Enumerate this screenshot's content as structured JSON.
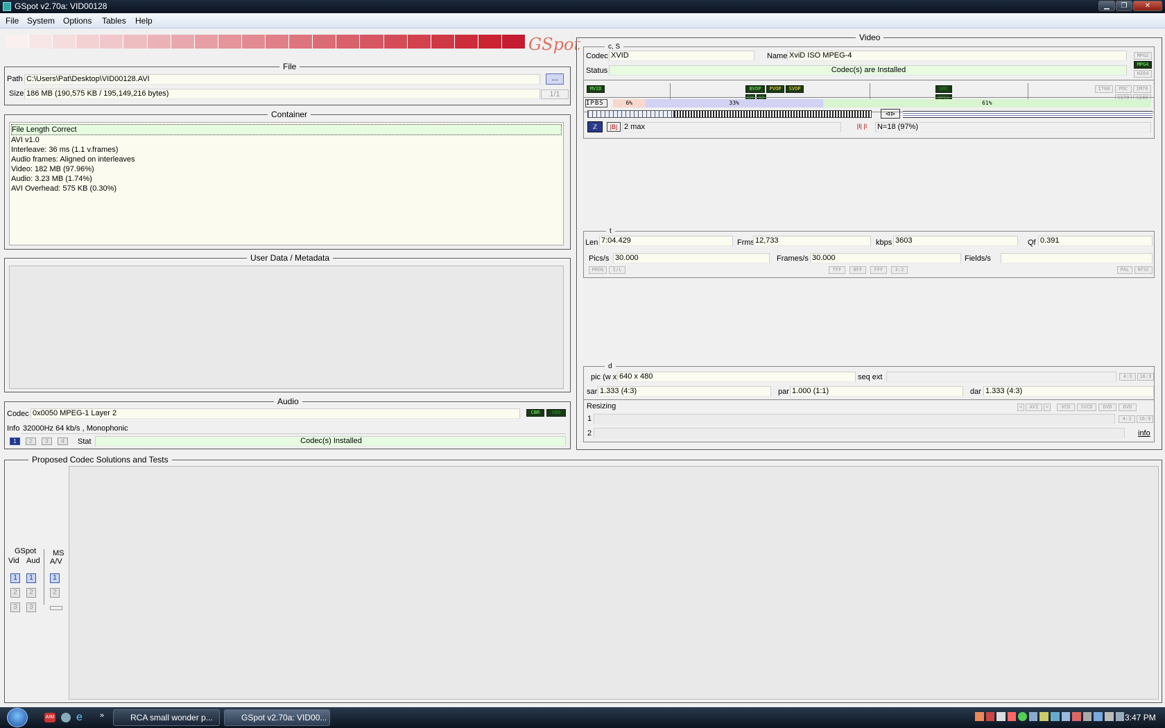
{
  "window": {
    "title": "GSpot v2.70a: VID00128"
  },
  "menu": [
    "File",
    "System",
    "Options",
    "Tables",
    "Help"
  ],
  "logo": "GSpot",
  "colors": {
    "accent_red": "#c41c30",
    "status_green": "#e6fbe0",
    "field_bg": "#fbfbf0"
  },
  "file": {
    "title": "File",
    "path_label": "Path",
    "path": "C:\\Users\\Pat\\Desktop\\VID00128.AVI",
    "browse": "...",
    "size_label": "Size",
    "size": "186 MB (190,575 KB / 195,149,216 bytes)",
    "counter": "1/1"
  },
  "container": {
    "title": "Container",
    "lines": [
      "File Length Correct",
      "AVI v1.0",
      "Interleave: 36 ms (1.1 v.frames)",
      "Audio frames: Aligned on interleaves",
      "Video: 182 MB (97.96%)",
      "Audio: 3.23 MB (1.74%)",
      "AVI Overhead: 575 KB (0.30%)"
    ]
  },
  "userdata": {
    "title": "User Data / Metadata"
  },
  "audio": {
    "title": "Audio",
    "codec_label": "Codec",
    "codec": "0x0050 MPEG-1 Layer 2",
    "cbr": "CBR",
    "vbr": "VBR",
    "info_label": "Info",
    "info": "32000Hz  64 kb/s , Monophonic",
    "streams": [
      "1",
      "2",
      "3",
      "4"
    ],
    "stat_label": "Stat",
    "stat": "Codec(s) Installed"
  },
  "video": {
    "title": "Video",
    "cs_label": "c, S",
    "codec_label": "Codec",
    "codec": "XVID",
    "name_label": "Name",
    "name": "XviD ISO MPEG-4",
    "status_label": "Status",
    "status": "Codec(s) are Installed",
    "side_tags": [
      "MPG2",
      "MPG4",
      "H264"
    ],
    "flags_left": [
      "MVID"
    ],
    "flags_mid": [
      "BVOP",
      "PVOP",
      "SVOP",
      "GM",
      "QP"
    ],
    "flags_right": [
      "GMC",
      "QPEL"
    ],
    "flags_far": [
      "I708",
      "POC",
      "IM70",
      "S170",
      "S240"
    ],
    "frame_types": "IPBS",
    "pct_i": "6%",
    "pct_p": "33%",
    "pct_b": "61%",
    "bmax": "2 max",
    "n_label": "N=18 (97%)",
    "t_label": "t",
    "len_label": "Len",
    "len": "7:04.429",
    "frms_label": "Frms",
    "frms": "12,733",
    "kbps_label": "kbps",
    "kbps": "3603",
    "qf_label": "Qf",
    "qf": "0.391",
    "pics_label": "Pics/s",
    "pics": "30.000",
    "frames_label": "Frames/s",
    "frames": "30.000",
    "fields_label": "Fields/s",
    "fields": "",
    "scan_tags": [
      "PROG",
      "I/L"
    ],
    "field_tags": [
      "TFF",
      "BFF",
      "FFF",
      "3:2"
    ],
    "std_tags": [
      "PAL",
      "NTSC"
    ],
    "d_label": "d",
    "pic_label": "pic (w x",
    "pic": "640 x 480",
    "seqext_label": "seq ext",
    "seqext": "",
    "ar_tags": [
      "4:3",
      "16:9"
    ],
    "sar_label": "sar",
    "sar": "1.333 (4:3)",
    "par_label": "par",
    "par": "1.000 (1:1)",
    "dar_label": "dar",
    "dar": "1.333 (4:3)",
    "resizing_label": "Resizing",
    "resize_tags": [
      "AVI",
      "VCD",
      "SVCD",
      "DVD",
      "DVD"
    ],
    "row1": "1",
    "row2": "2",
    "info_link": "info"
  },
  "proposed": {
    "title": "Proposed Codec Solutions and Tests",
    "gspot": "GSpot",
    "vid": "Vid",
    "aud": "Aud",
    "ms": "MS",
    "av": "A/V",
    "n1": "1",
    "n2": "2",
    "n3": "3"
  },
  "taskbar": {
    "task1": "RCA small wonder p...",
    "task2": "GSpot v2.70a: VID00...",
    "clock": "3:47 PM"
  }
}
